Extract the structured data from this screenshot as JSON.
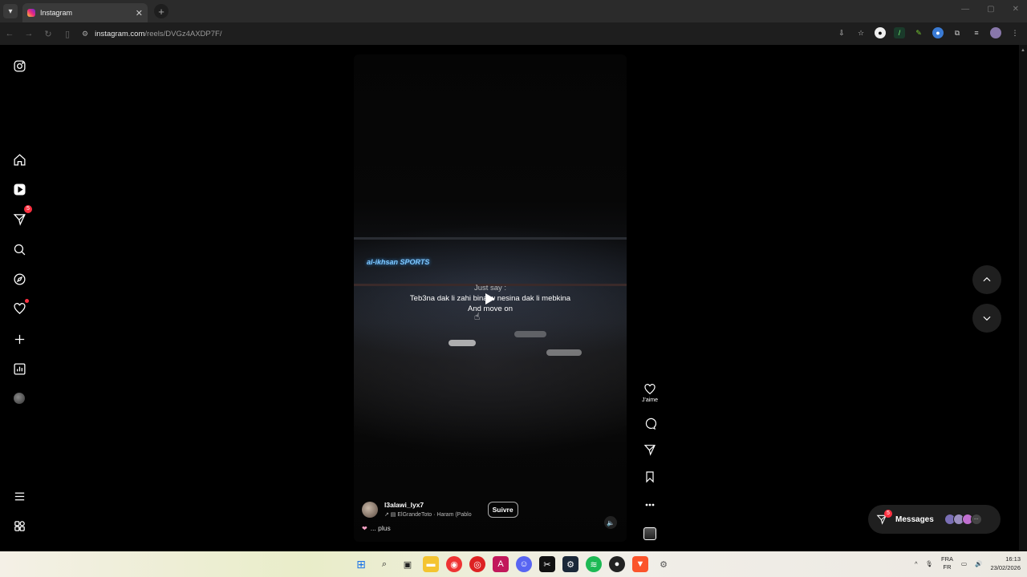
{
  "browser": {
    "tab_title": "Instagram",
    "url_host": "instagram.com",
    "url_path": "/reels/DVGz4AXDP7F/"
  },
  "sidebar": {
    "notifications_badge": "5"
  },
  "reel": {
    "overlay_line1": "Just say :",
    "overlay_line2": "Teb3na dak li zahi bina w nesina dak li mebkina",
    "overlay_line3": "And move on",
    "sign_text": "al-ikhsan SPORTS",
    "username": "l3alawi_lyx7",
    "audio": "ElGrandeToto · Haram (Pablo",
    "follow_label": "Suivre",
    "caption_more": "... plus"
  },
  "actions": {
    "like_label": "J'aime"
  },
  "messages": {
    "label": "Messages",
    "badge": "5"
  },
  "taskbar": {
    "lang_top": "FRA",
    "lang_bottom": "FR",
    "time": "16:13",
    "date": "23/02/2026"
  }
}
